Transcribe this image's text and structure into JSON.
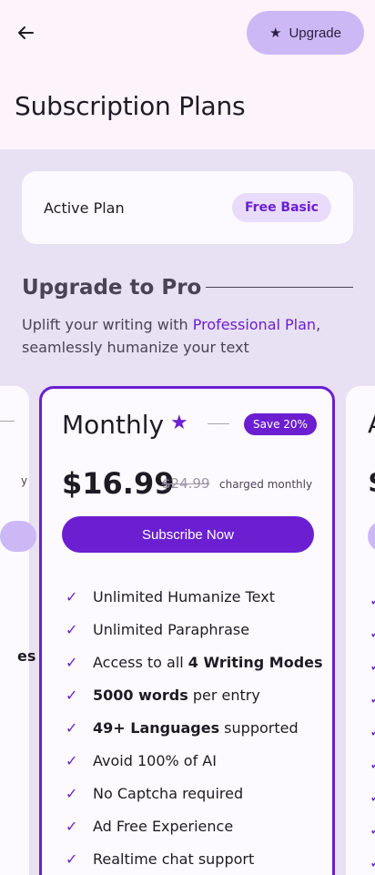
{
  "header": {
    "back_icon": "arrow-left-icon",
    "upgrade_label": "Upgrade",
    "upgrade_icon": "star-icon",
    "title": "Subscription Plans"
  },
  "active_plan": {
    "label": "Active Plan",
    "badge": "Free Basic"
  },
  "upgrade_section": {
    "title": "Upgrade to Pro",
    "subtitle_before": "Uplift your writing with ",
    "subtitle_highlight": "Professional Plan",
    "subtitle_after": ", seamlessly humanize your text"
  },
  "left_plan_partial": {
    "text_line": "y",
    "text_bold": "es"
  },
  "right_plan_partial": {
    "name_initial": "A",
    "price_initial": "$"
  },
  "plan": {
    "name": "Monthly",
    "save_badge": "Save 20%",
    "price": "$16.99",
    "old_price": "$24.99",
    "charged": "charged monthly",
    "subscribe_label": "Subscribe Now",
    "features": [
      {
        "pre": "Unlimited Humanize Text",
        "bold": "",
        "post": ""
      },
      {
        "pre": "Unlimited Paraphrase",
        "bold": "",
        "post": ""
      },
      {
        "pre": "Access to all ",
        "bold": "4 Writing Modes",
        "post": ""
      },
      {
        "pre": "",
        "bold": "5000 words",
        "post": " per entry"
      },
      {
        "pre": "",
        "bold": "49+ Languages",
        "post": " supported"
      },
      {
        "pre": "Avoid 100% of AI",
        "bold": "",
        "post": ""
      },
      {
        "pre": "No Captcha required",
        "bold": "",
        "post": ""
      },
      {
        "pre": "Ad Free Experience",
        "bold": "",
        "post": ""
      },
      {
        "pre": "Realtime chat support",
        "bold": "",
        "post": ""
      }
    ]
  },
  "colors": {
    "accent": "#6b1fd0",
    "accent_light": "#cdb8f6",
    "section_bg": "#e8e0f3",
    "page_bg": "#fdf4fb"
  }
}
